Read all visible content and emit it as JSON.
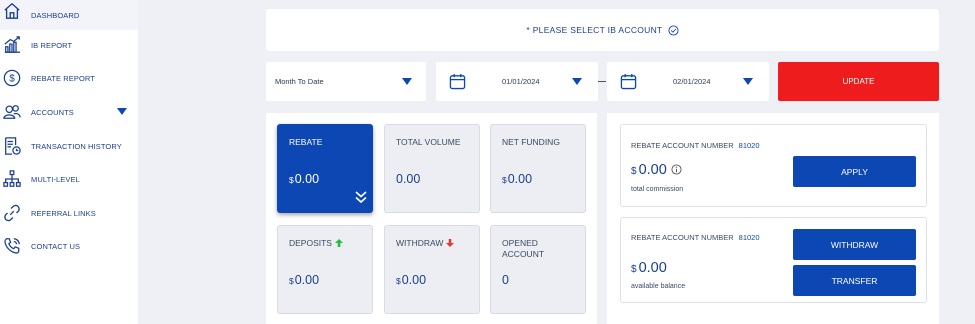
{
  "sidebar": {
    "items": [
      {
        "label": "DASHBOARD",
        "icon": "home-icon"
      },
      {
        "label": "IB REPORT",
        "icon": "bar-chart-icon"
      },
      {
        "label": "REBATE REPORT",
        "icon": "dollar-circle-icon"
      },
      {
        "label": "ACCOUNTS",
        "icon": "users-icon"
      },
      {
        "label": "TRANSACTION HISTORY",
        "icon": "history-document-icon"
      },
      {
        "label": "MULTI-LEVEL",
        "icon": "hierarchy-icon"
      },
      {
        "label": "REFERRAL LINKS",
        "icon": "link-icon"
      },
      {
        "label": "CONTACT US",
        "icon": "phone-icon"
      }
    ]
  },
  "banner": {
    "text": "* PLEASE SELECT IB ACCOUNT"
  },
  "filters": {
    "period": "Month To Date",
    "start_date": "01/01/2024",
    "end_date": "02/01/2024",
    "update_label": "UPDATE"
  },
  "cards": {
    "rebate": {
      "label": "REBATE",
      "currency": "$",
      "value": "0.00"
    },
    "total_volume": {
      "label": "TOTAL VOLUME",
      "value": "0.00"
    },
    "net_funding": {
      "label": "NET FUNDING",
      "currency": "$",
      "value": "0.00"
    },
    "deposits": {
      "label": "DEPOSITS",
      "currency": "$",
      "value": "0.00"
    },
    "withdraw": {
      "label": "WITHDRAW",
      "currency": "$",
      "value": "0.00"
    },
    "opened_account": {
      "label": "OPENED ACCOUNT",
      "value": "0"
    }
  },
  "rebate_accounts": [
    {
      "label": "REBATE ACCOUNT NUMBER",
      "number": "81020",
      "currency": "$",
      "amount": "0.00",
      "sub": "total commission",
      "button": "APPLY"
    },
    {
      "label": "REBATE ACCOUNT NUMBER",
      "number": "81020",
      "currency": "$",
      "amount": "0.00",
      "sub": "available balance",
      "buttons": [
        "WITHDRAW",
        "TRANSFER"
      ]
    }
  ],
  "colors": {
    "accent": "#0d47b3",
    "update": "#ee1c1c",
    "up_arrow": "#1fbf3a",
    "down_arrow": "#e53935"
  }
}
